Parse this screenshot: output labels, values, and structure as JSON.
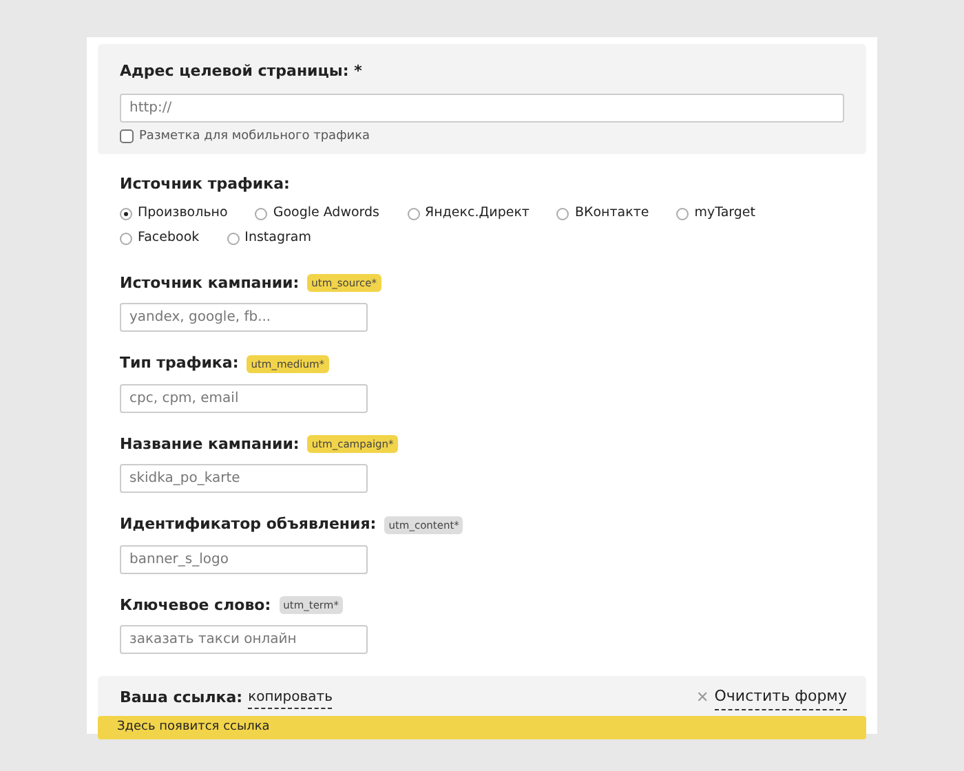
{
  "url_section": {
    "label": "Адрес целевой страницы: *",
    "placeholder": "http://",
    "mobile_checkbox": {
      "label": "Разметка для мобильного трафика",
      "checked": false
    }
  },
  "traffic_source": {
    "label": "Источник трафика:",
    "options": [
      {
        "label": "Произвольно",
        "selected": true
      },
      {
        "label": "Google Adwords",
        "selected": false
      },
      {
        "label": "Яндекс.Директ",
        "selected": false
      },
      {
        "label": "ВКонтакте",
        "selected": false
      },
      {
        "label": "myTarget",
        "selected": false
      },
      {
        "label": "Facebook",
        "selected": false
      },
      {
        "label": "Instagram",
        "selected": false
      }
    ]
  },
  "fields": [
    {
      "label": "Источник кампании:",
      "tag": "utm_source*",
      "color": "#f2d44a",
      "placeholder": "yandex, google, fb..."
    },
    {
      "label": "Тип трафика:",
      "tag": "utm_medium*",
      "color": "#f2d44a",
      "placeholder": "cpc, cpm, email"
    },
    {
      "label": "Название кампании:",
      "tag": "utm_campaign*",
      "color": "#f2d44a",
      "placeholder": "skidka_po_karte"
    },
    {
      "label": "Идентификатор объявления:",
      "tag": "utm_content*",
      "color": "#dddddd",
      "placeholder": "banner_s_logo"
    },
    {
      "label": "Ключевое слово:",
      "tag": "utm_term*",
      "color": "#dddddd",
      "placeholder": "заказать такси онлайн"
    }
  ],
  "result": {
    "label": "Ваша ссылка:",
    "copy_link": "копировать",
    "clear_icon": "✕",
    "clear_link": "Очистить форму",
    "output": "Здесь появится ссылка"
  }
}
